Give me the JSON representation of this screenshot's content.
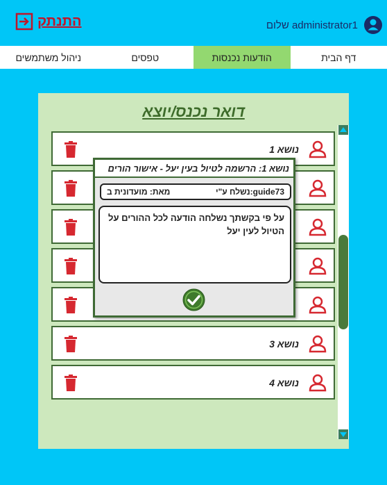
{
  "header": {
    "logout_label": "התנתק",
    "greeting": "שלום administrator1"
  },
  "nav": {
    "items": [
      {
        "label": "דף הבית"
      },
      {
        "label": "הודעות נכנסות"
      },
      {
        "label": "טפסים"
      },
      {
        "label": "ניהול משתמשים"
      }
    ],
    "active_index": 1
  },
  "mailbox": {
    "title": "דואר נכנס/יוצא",
    "messages": [
      {
        "subject": "נושא 1"
      },
      {
        "subject": ""
      },
      {
        "subject": ""
      },
      {
        "subject": ""
      },
      {
        "subject": ""
      },
      {
        "subject": "נושא 3"
      },
      {
        "subject": "נושא 4"
      }
    ]
  },
  "modal": {
    "title": "נושא 1: הרשמה לטיול בעין יעל - אישור הורים",
    "sent_by": "נשלח ע\"י:guide73",
    "from": "מאת: מועדונית ב",
    "body": "על פי בקשתך נשלחה הודעה לכל ההורים על הטיול לעין יעל"
  },
  "colors": {
    "background": "#00c6f7",
    "nav_active": "#93d870",
    "panel": "#cde8bd",
    "accent_red": "#d62830",
    "border_green": "#3f6a35"
  },
  "icons": {
    "logout": "logout-icon",
    "user": "user-avatar-icon",
    "delete": "trash-icon",
    "ok": "check-circle-icon"
  }
}
